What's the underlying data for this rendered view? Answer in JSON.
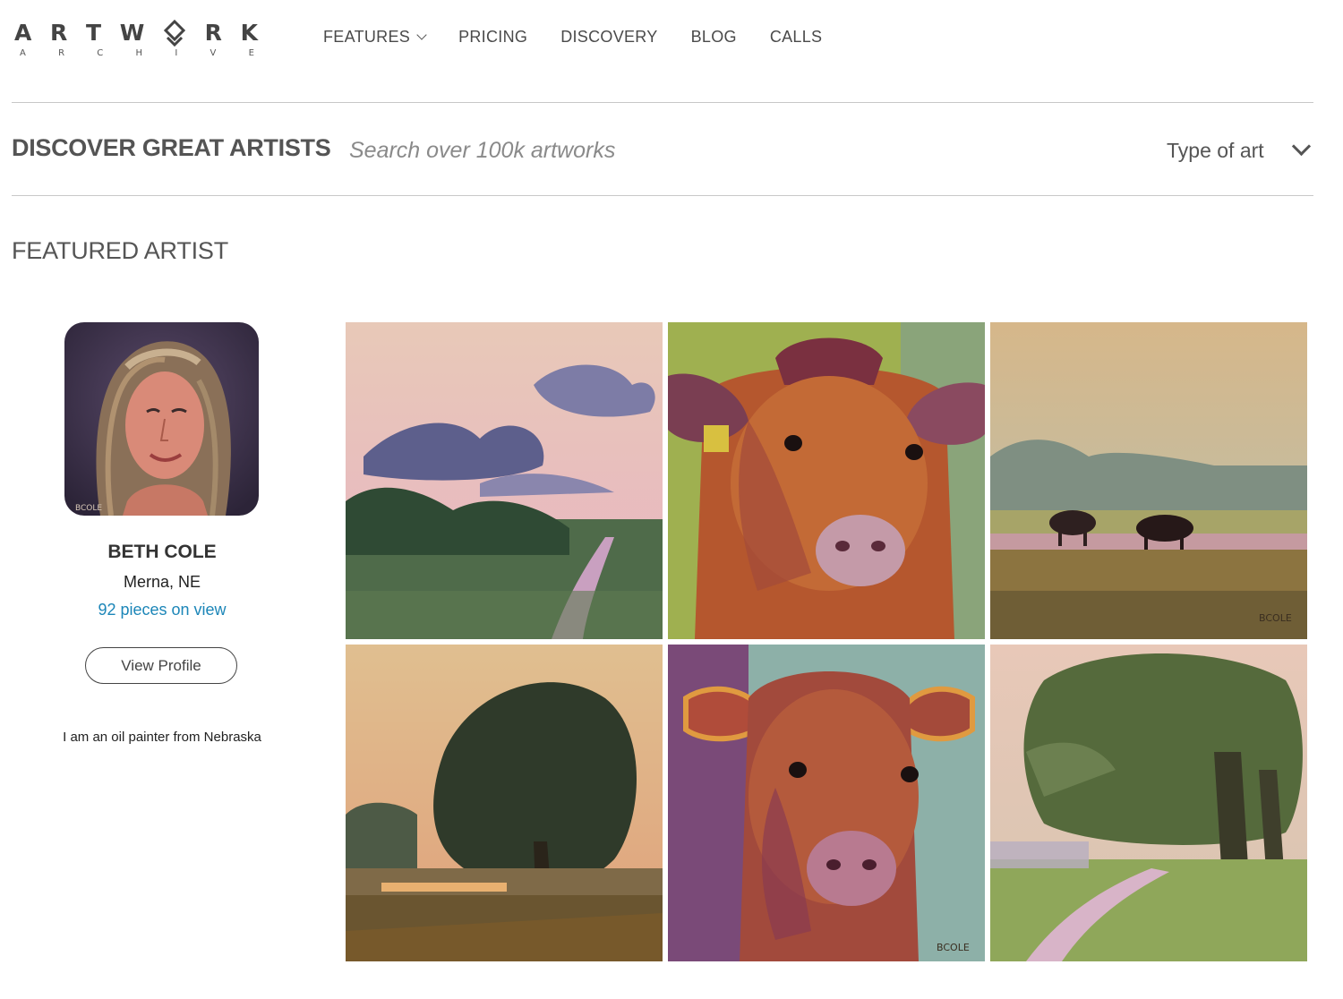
{
  "logo": {
    "top_letters": [
      "A",
      "R",
      "T",
      "W",
      "",
      "R",
      "K"
    ],
    "bottom_letters": [
      "A",
      "R",
      "C",
      "H",
      "I",
      "V",
      "E"
    ]
  },
  "nav": [
    {
      "label": "FEATURES",
      "has_dropdown": true
    },
    {
      "label": "PRICING"
    },
    {
      "label": "DISCOVERY"
    },
    {
      "label": "BLOG"
    },
    {
      "label": "CALLS"
    }
  ],
  "discover": {
    "title": "DISCOVER GREAT ARTISTS",
    "search_placeholder": "Search over 100k artworks",
    "type_filter_label": "Type of art"
  },
  "featured": {
    "title": "FEATURED ARTIST",
    "artist": {
      "name": "BETH COLE",
      "location": "Merna, NE",
      "pieces": "92 pieces on view",
      "view_profile_label": "View Profile",
      "bio": "I am an oil painter from Nebraska"
    },
    "artworks": [
      {
        "subject": "landscape-clouds-creek"
      },
      {
        "subject": "cow-portrait"
      },
      {
        "subject": "pasture-two-cows",
        "signature": "BCOLE"
      },
      {
        "subject": "tree-sunset-landscape"
      },
      {
        "subject": "cow-portrait-2",
        "signature": "BCOLE"
      },
      {
        "subject": "tree-path-landscape"
      }
    ]
  },
  "colors": {
    "link_blue": "#1c86b8",
    "heading_gray": "#555555",
    "rule_gray": "#c8c8c8"
  }
}
